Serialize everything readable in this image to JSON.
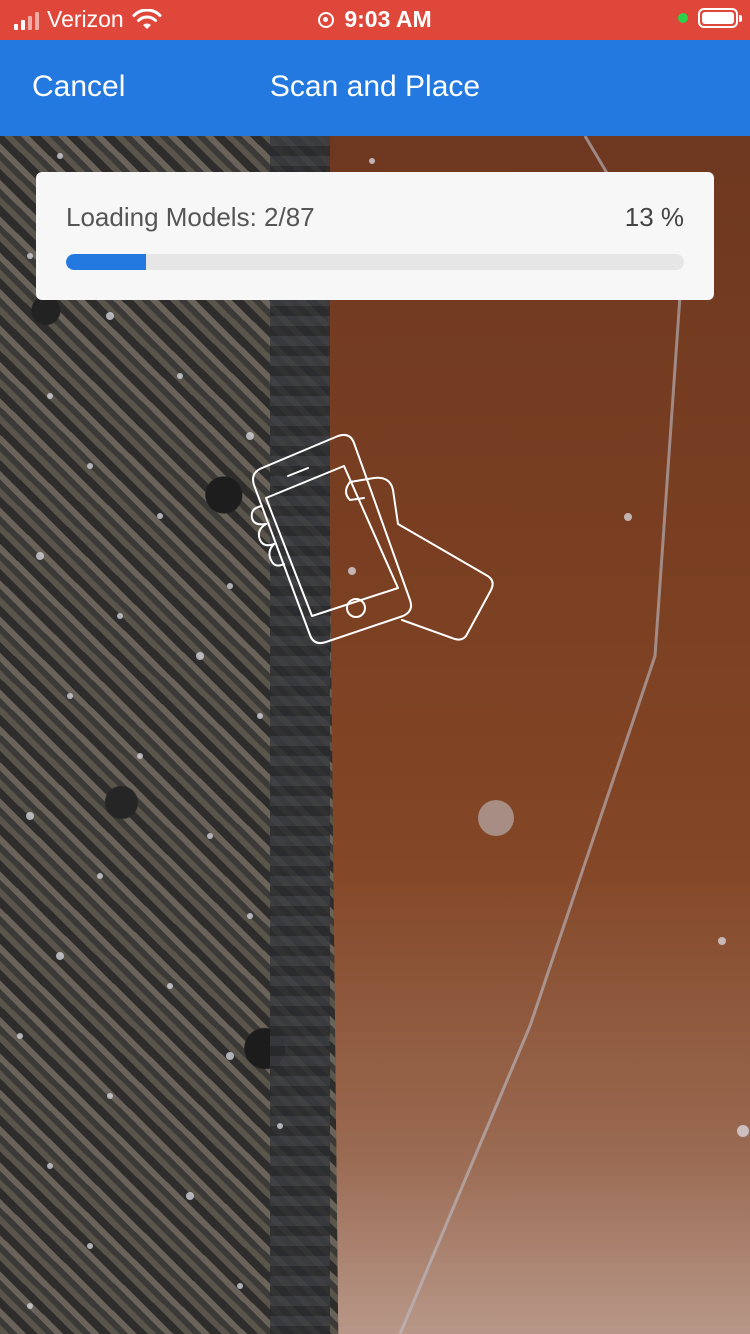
{
  "status_bar": {
    "carrier": "Verizon",
    "time": "9:03 AM",
    "icons": [
      "signal-icon",
      "wifi-icon",
      "alarm-icon",
      "green-dot-indicator",
      "battery-icon"
    ]
  },
  "nav_bar": {
    "cancel_label": "Cancel",
    "title": "Scan and Place"
  },
  "loading": {
    "label": "Loading Models: 2/87",
    "percent_text": "13 %",
    "progress": 0.13
  },
  "illustration": {
    "icon": "hand-holding-phone-icon"
  },
  "colors": {
    "status_bar": "#e0473b",
    "nav_bar": "#2479e0",
    "progress_fill": "#2479e0",
    "card_bg": "#f7f7f7"
  }
}
